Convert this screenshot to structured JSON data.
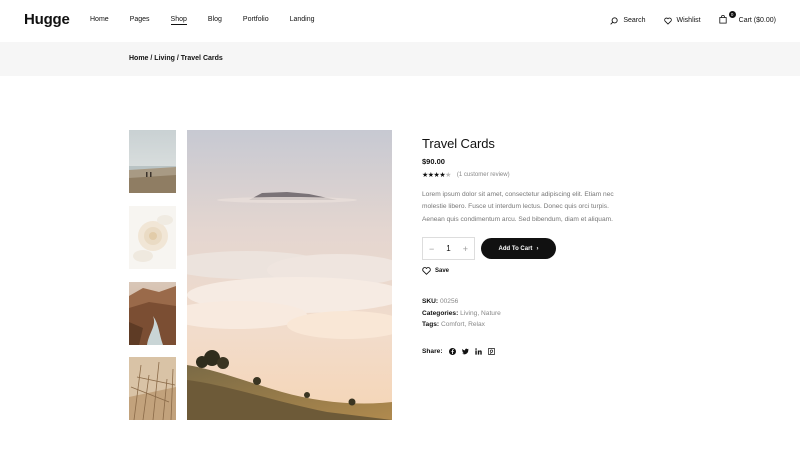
{
  "header": {
    "logo": "Hugge",
    "nav": [
      {
        "label": "Home"
      },
      {
        "label": "Pages"
      },
      {
        "label": "Shop",
        "active": true
      },
      {
        "label": "Blog"
      },
      {
        "label": "Portfolio"
      },
      {
        "label": "Landing"
      }
    ],
    "search_label": "Search",
    "wishlist_label": "Wishlist",
    "cart_label": "Cart ($0.00)",
    "cart_count": "0"
  },
  "breadcrumb": [
    "Home",
    "Living",
    "Travel Cards"
  ],
  "gallery": {
    "thumbnails": [
      "thumb-beach-walk",
      "thumb-flowers",
      "thumb-canyon-river",
      "thumb-dry-grass"
    ],
    "main": "sea-of-clouds"
  },
  "product": {
    "title": "Travel Cards",
    "price": "$90.00",
    "rating": 4,
    "rating_max": 5,
    "review_text": "(1 customer review)",
    "description": "Lorem ipsum dolor sit amet, consectetur adipiscing elit. Etiam nec molestie libero. Fusce ut interdum lectus. Donec quis orci turpis. Aenean quis condimentum arcu. Sed bibendum, diam et aliquam.",
    "quantity": "1",
    "qty_minus": "−",
    "qty_plus": "+",
    "add_to_cart": "Add To Cart",
    "add_arrow": "›",
    "save_label": "Save",
    "sku_label": "SKU:",
    "sku": "00256",
    "categories_label": "Categories:",
    "categories": "Living, Nature",
    "tags_label": "Tags:",
    "tags": "Comfort, Relax",
    "share_label": "Share:",
    "share_icons": [
      "facebook-icon",
      "twitter-icon",
      "linkedin-icon",
      "pinterest-icon"
    ]
  },
  "colors": {
    "accent": "#111111",
    "breadcrumb_bg": "#f6f6f6",
    "muted_text": "#888888"
  }
}
